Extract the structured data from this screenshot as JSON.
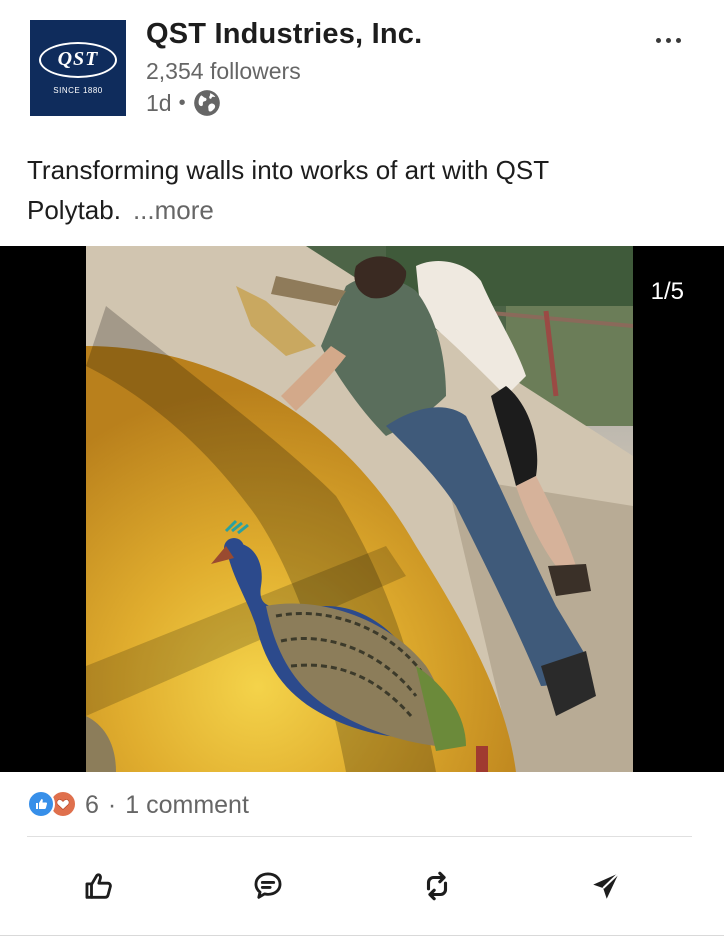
{
  "post": {
    "author": {
      "name": "QST Industries, Inc.",
      "followers": "2,354 followers",
      "time": "1d",
      "separator": "•",
      "logo_text": "QST",
      "logo_since": "SINCE 1880"
    },
    "icons": {
      "visibility": "globe-icon",
      "menu": "more-horizontal-icon"
    },
    "text": "Transforming walls into works of art with QST Polytab.",
    "see_more": "...more",
    "media": {
      "counter": "1/5"
    },
    "social": {
      "reactions_count": "6",
      "separator": "·",
      "comments": "1 comment",
      "reaction_icons": [
        "like-icon",
        "love-icon"
      ]
    },
    "actions": [
      {
        "icon": "like-icon"
      },
      {
        "icon": "comment-icon"
      },
      {
        "icon": "repost-icon"
      },
      {
        "icon": "send-icon"
      }
    ],
    "colors": {
      "brand_navy": "#0f2c5c",
      "like_blue": "#378fe9",
      "love_red": "#df704d",
      "secondary_text": "#666666"
    }
  }
}
